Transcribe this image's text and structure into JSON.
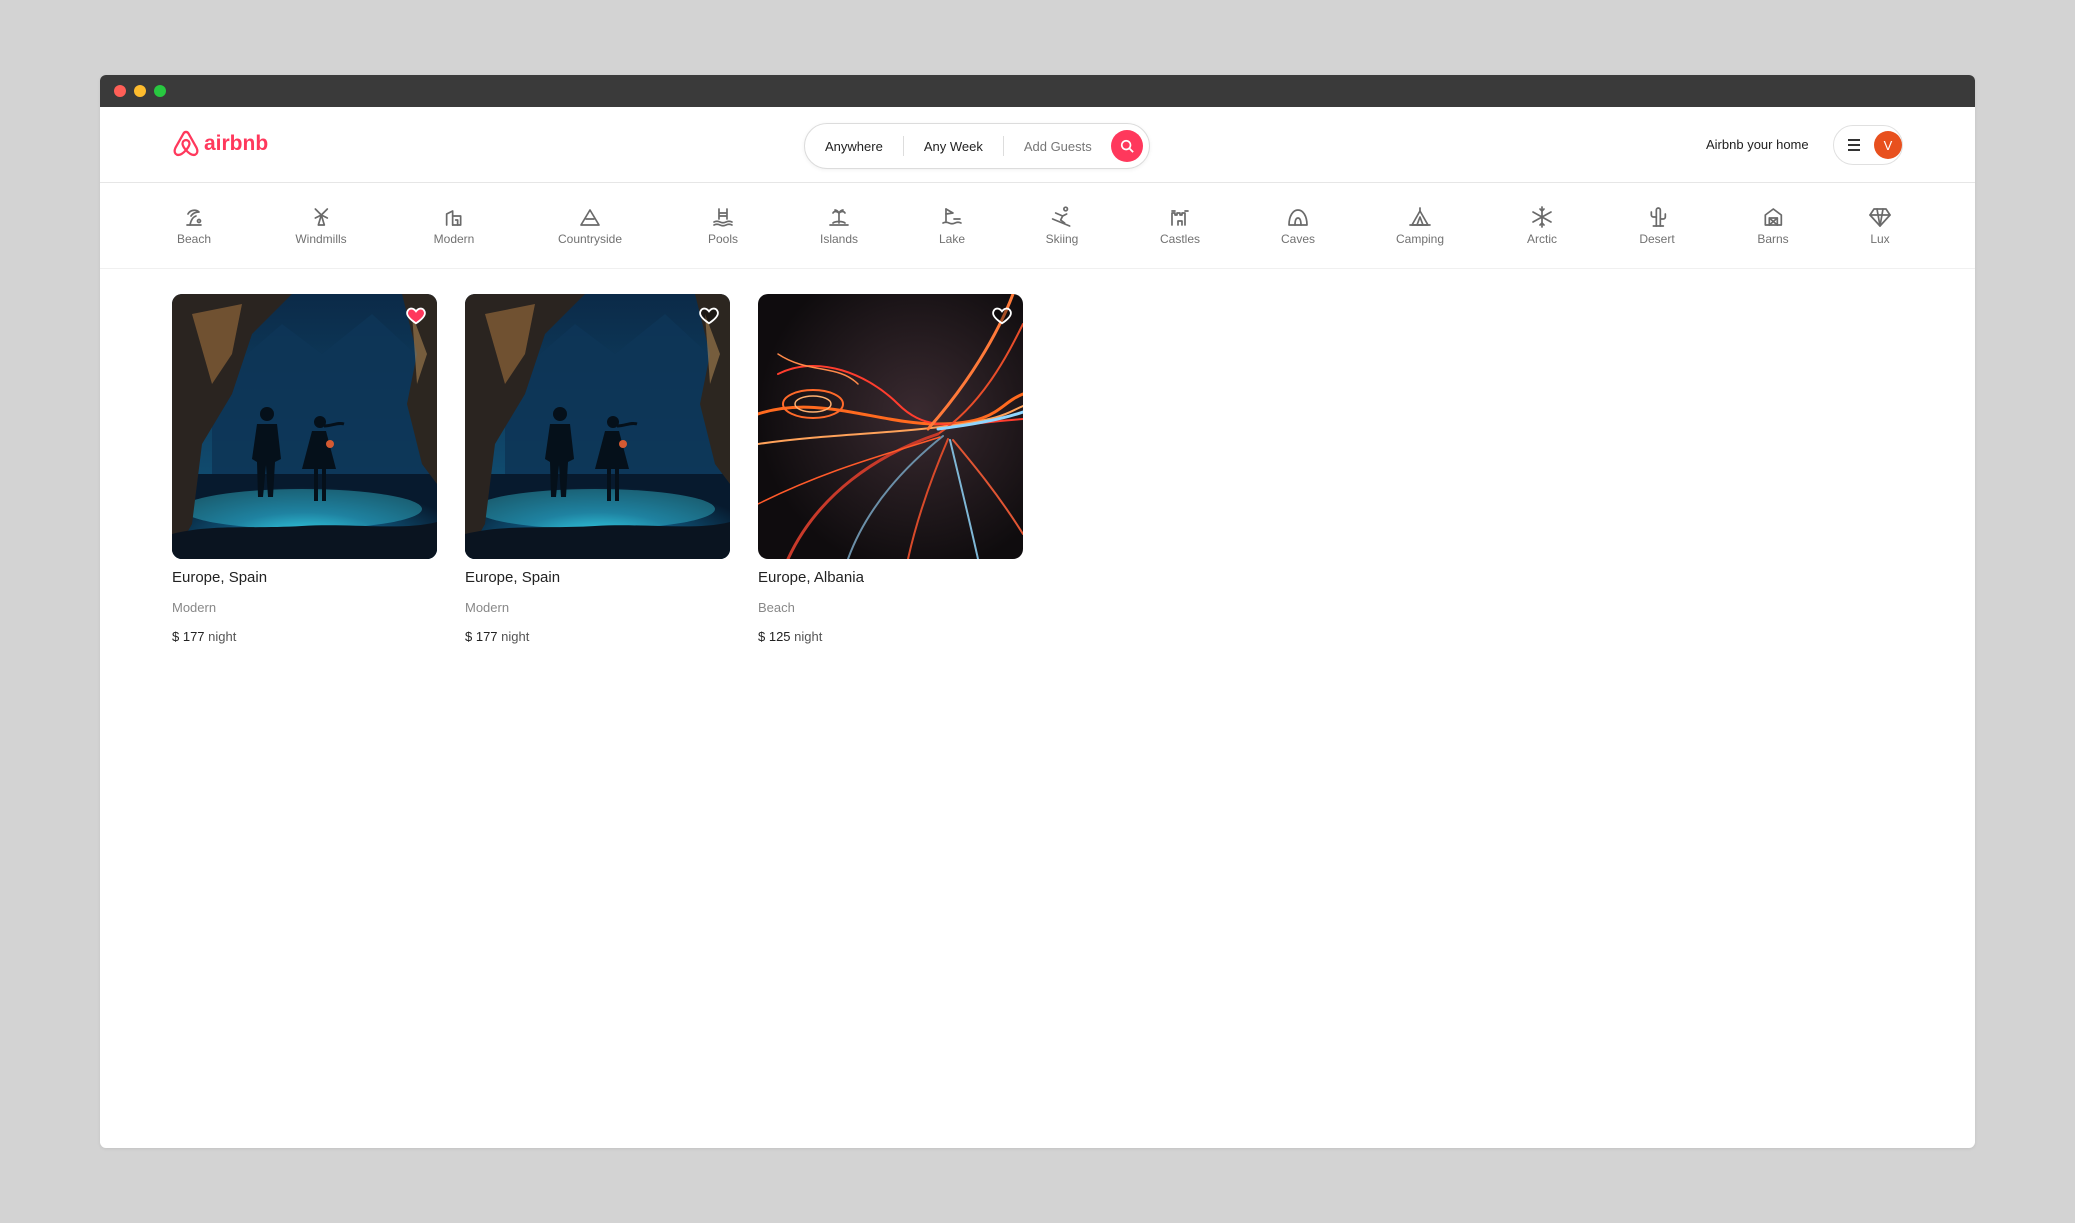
{
  "window": {
    "dots": [
      "#FF5F57",
      "#FEBC2E",
      "#28C840"
    ]
  },
  "header": {
    "brand": "airbnb",
    "brand_color": "#FF385C",
    "search": {
      "where": "Anywhere",
      "when": "Any Week",
      "guests": "Add Guests"
    },
    "host_link": "Airbnb your home",
    "avatar_letter": "V",
    "avatar_color": "#E8501E"
  },
  "categories": [
    {
      "label": "Beach",
      "icon": "beach-icon"
    },
    {
      "label": "Windmills",
      "icon": "windmill-icon"
    },
    {
      "label": "Modern",
      "icon": "modern-house-icon"
    },
    {
      "label": "Countryside",
      "icon": "mountain-icon"
    },
    {
      "label": "Pools",
      "icon": "pool-icon"
    },
    {
      "label": "Islands",
      "icon": "island-icon"
    },
    {
      "label": "Lake",
      "icon": "lake-icon"
    },
    {
      "label": "Skiing",
      "icon": "skiing-icon"
    },
    {
      "label": "Castles",
      "icon": "castle-icon"
    },
    {
      "label": "Caves",
      "icon": "cave-icon"
    },
    {
      "label": "Camping",
      "icon": "tent-icon"
    },
    {
      "label": "Arctic",
      "icon": "snowflake-icon"
    },
    {
      "label": "Desert",
      "icon": "cactus-icon"
    },
    {
      "label": "Barns",
      "icon": "barn-icon"
    },
    {
      "label": "Lux",
      "icon": "diamond-icon"
    }
  ],
  "listings": [
    {
      "location": "Europe, Spain",
      "category": "Modern",
      "price": "$ 177",
      "unit": "night",
      "favorited": true,
      "image": "cave-couple"
    },
    {
      "location": "Europe, Spain",
      "category": "Modern",
      "price": "$ 177",
      "unit": "night",
      "favorited": false,
      "image": "cave-couple"
    },
    {
      "location": "Europe, Albania",
      "category": "Beach",
      "price": "$ 125",
      "unit": "night",
      "favorited": false,
      "image": "neon-tunnel"
    }
  ]
}
